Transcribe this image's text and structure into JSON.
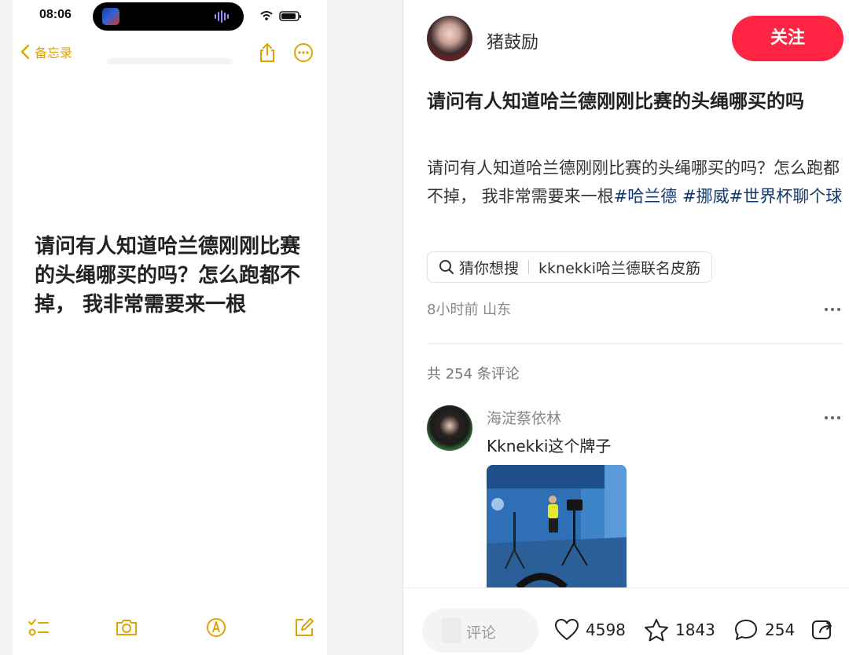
{
  "notes": {
    "status_time": "08:06",
    "back_label": "备忘录",
    "body": "请问有人知道哈兰德刚刚比赛的头绳哪买的吗？怎么跑都不掉， 我非常需要来一根",
    "accent_color": "#e0a400",
    "icons": [
      "chevron-left-icon",
      "share-icon",
      "more-icon",
      "checklist-icon",
      "camera-icon",
      "markup-icon",
      "compose-icon"
    ]
  },
  "post": {
    "author": "猪鼓励",
    "follow_label": "关注",
    "title": "请问有人知道哈兰德刚刚比赛的头绳哪买的吗",
    "body_text": "请问有人知道哈兰德刚刚比赛的头绳哪买的吗？怎么跑都不掉， 我非常需要来一根",
    "hashtags": [
      "#哈兰德",
      "#挪威",
      "#世界杯聊个球"
    ],
    "guess_label": "猜你想搜",
    "guess_query": "kknekki哈兰德联名皮筋",
    "meta": "8小时前 山东",
    "comment_count_label": "共 254 条评论",
    "brand_color": "#ff2442",
    "hashtag_color": "#13386c"
  },
  "comment": {
    "author": "海淀蔡依林",
    "text": "Kknekki这个牌子"
  },
  "bottom": {
    "input_placeholder": "评论",
    "likes": "4598",
    "favorites": "1843",
    "comments": "254"
  }
}
